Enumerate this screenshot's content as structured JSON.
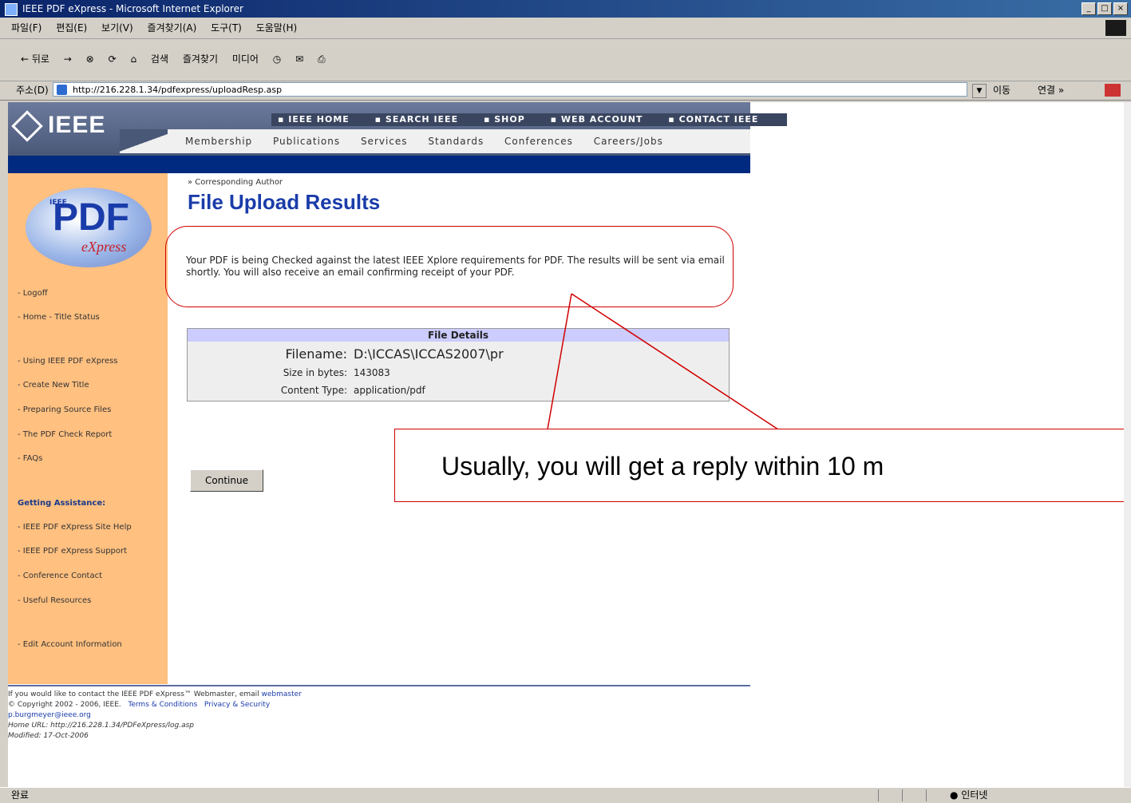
{
  "window": {
    "title": "IEEE PDF eXpress - Microsoft Internet Explorer",
    "controls": [
      "_",
      "□",
      "×"
    ]
  },
  "menu": [
    "파일(F)",
    "편집(E)",
    "보기(V)",
    "즐겨찾기(A)",
    "도구(T)",
    "도움말(H)"
  ],
  "toolbar": {
    "back": "← 뒤로",
    "forward": "→",
    "search": "검색",
    "favorites": "즐겨찾기",
    "media": "미디어"
  },
  "address": {
    "label": "주소(D)",
    "url": "http://216.228.1.34/pdfexpress/uploadResp.asp",
    "go": "이동",
    "links": "연결 »"
  },
  "ieee": {
    "logo": "IEEE",
    "topnav": [
      "IEEE HOME",
      "SEARCH IEEE",
      "SHOP",
      "WEB ACCOUNT",
      "CONTACT IEEE"
    ],
    "mainnav": [
      "Membership",
      "Publications",
      "Services",
      "Standards",
      "Conferences",
      "Careers/Jobs"
    ]
  },
  "sidebar": {
    "logo": {
      "ieee": "IEEE",
      "pdf": "PDF",
      "express": "eXpress"
    },
    "items": [
      "- Logoff",
      "- Home - Title Status",
      "- Using IEEE PDF eXpress",
      "- Create New Title",
      "- Preparing Source Files",
      "- The PDF Check Report",
      "- FAQs"
    ],
    "assistance_heading": "Getting Assistance:",
    "assistance_items": [
      "- IEEE PDF eXpress Site Help",
      "- IEEE PDF eXpress Support",
      "- Conference Contact",
      "- Useful Resources"
    ],
    "edit_account": "- Edit Account Information"
  },
  "main": {
    "breadcrumb": "» Corresponding Author",
    "title": "File Upload Results",
    "message": "Your PDF is being Checked against the latest IEEE Xplore requirements for PDF. The results will be sent via email shortly. You will also receive an email confirming receipt of your PDF.",
    "details": {
      "header": "File Details",
      "filename_label": "Filename:",
      "filename_value": "D:\\ICCAS\\ICCAS2007\\pr",
      "size_label": "Size in bytes:",
      "size_value": "143083",
      "type_label": "Content Type:",
      "type_value": "application/pdf"
    },
    "continue": "Continue"
  },
  "footer": {
    "contact_line": "If you would like to contact the IEEE PDF eXpress™ Webmaster, email",
    "webmaster": "webmaster",
    "copyright": "© Copyright 2002 - 2006, IEEE.",
    "terms": "Terms & Conditions",
    "privacy": "Privacy & Security",
    "email": "p.burgmeyer@ieee.org",
    "url": "Home URL: http://216.228.1.34/PDFeXpress/log.asp",
    "modified": "Modified: 17-Oct-2006"
  },
  "annotation": {
    "callout_text": "Usually, you will get a reply within 10 m",
    "color": "#d00000"
  },
  "status": {
    "left": "완료",
    "right": "인터넷"
  }
}
